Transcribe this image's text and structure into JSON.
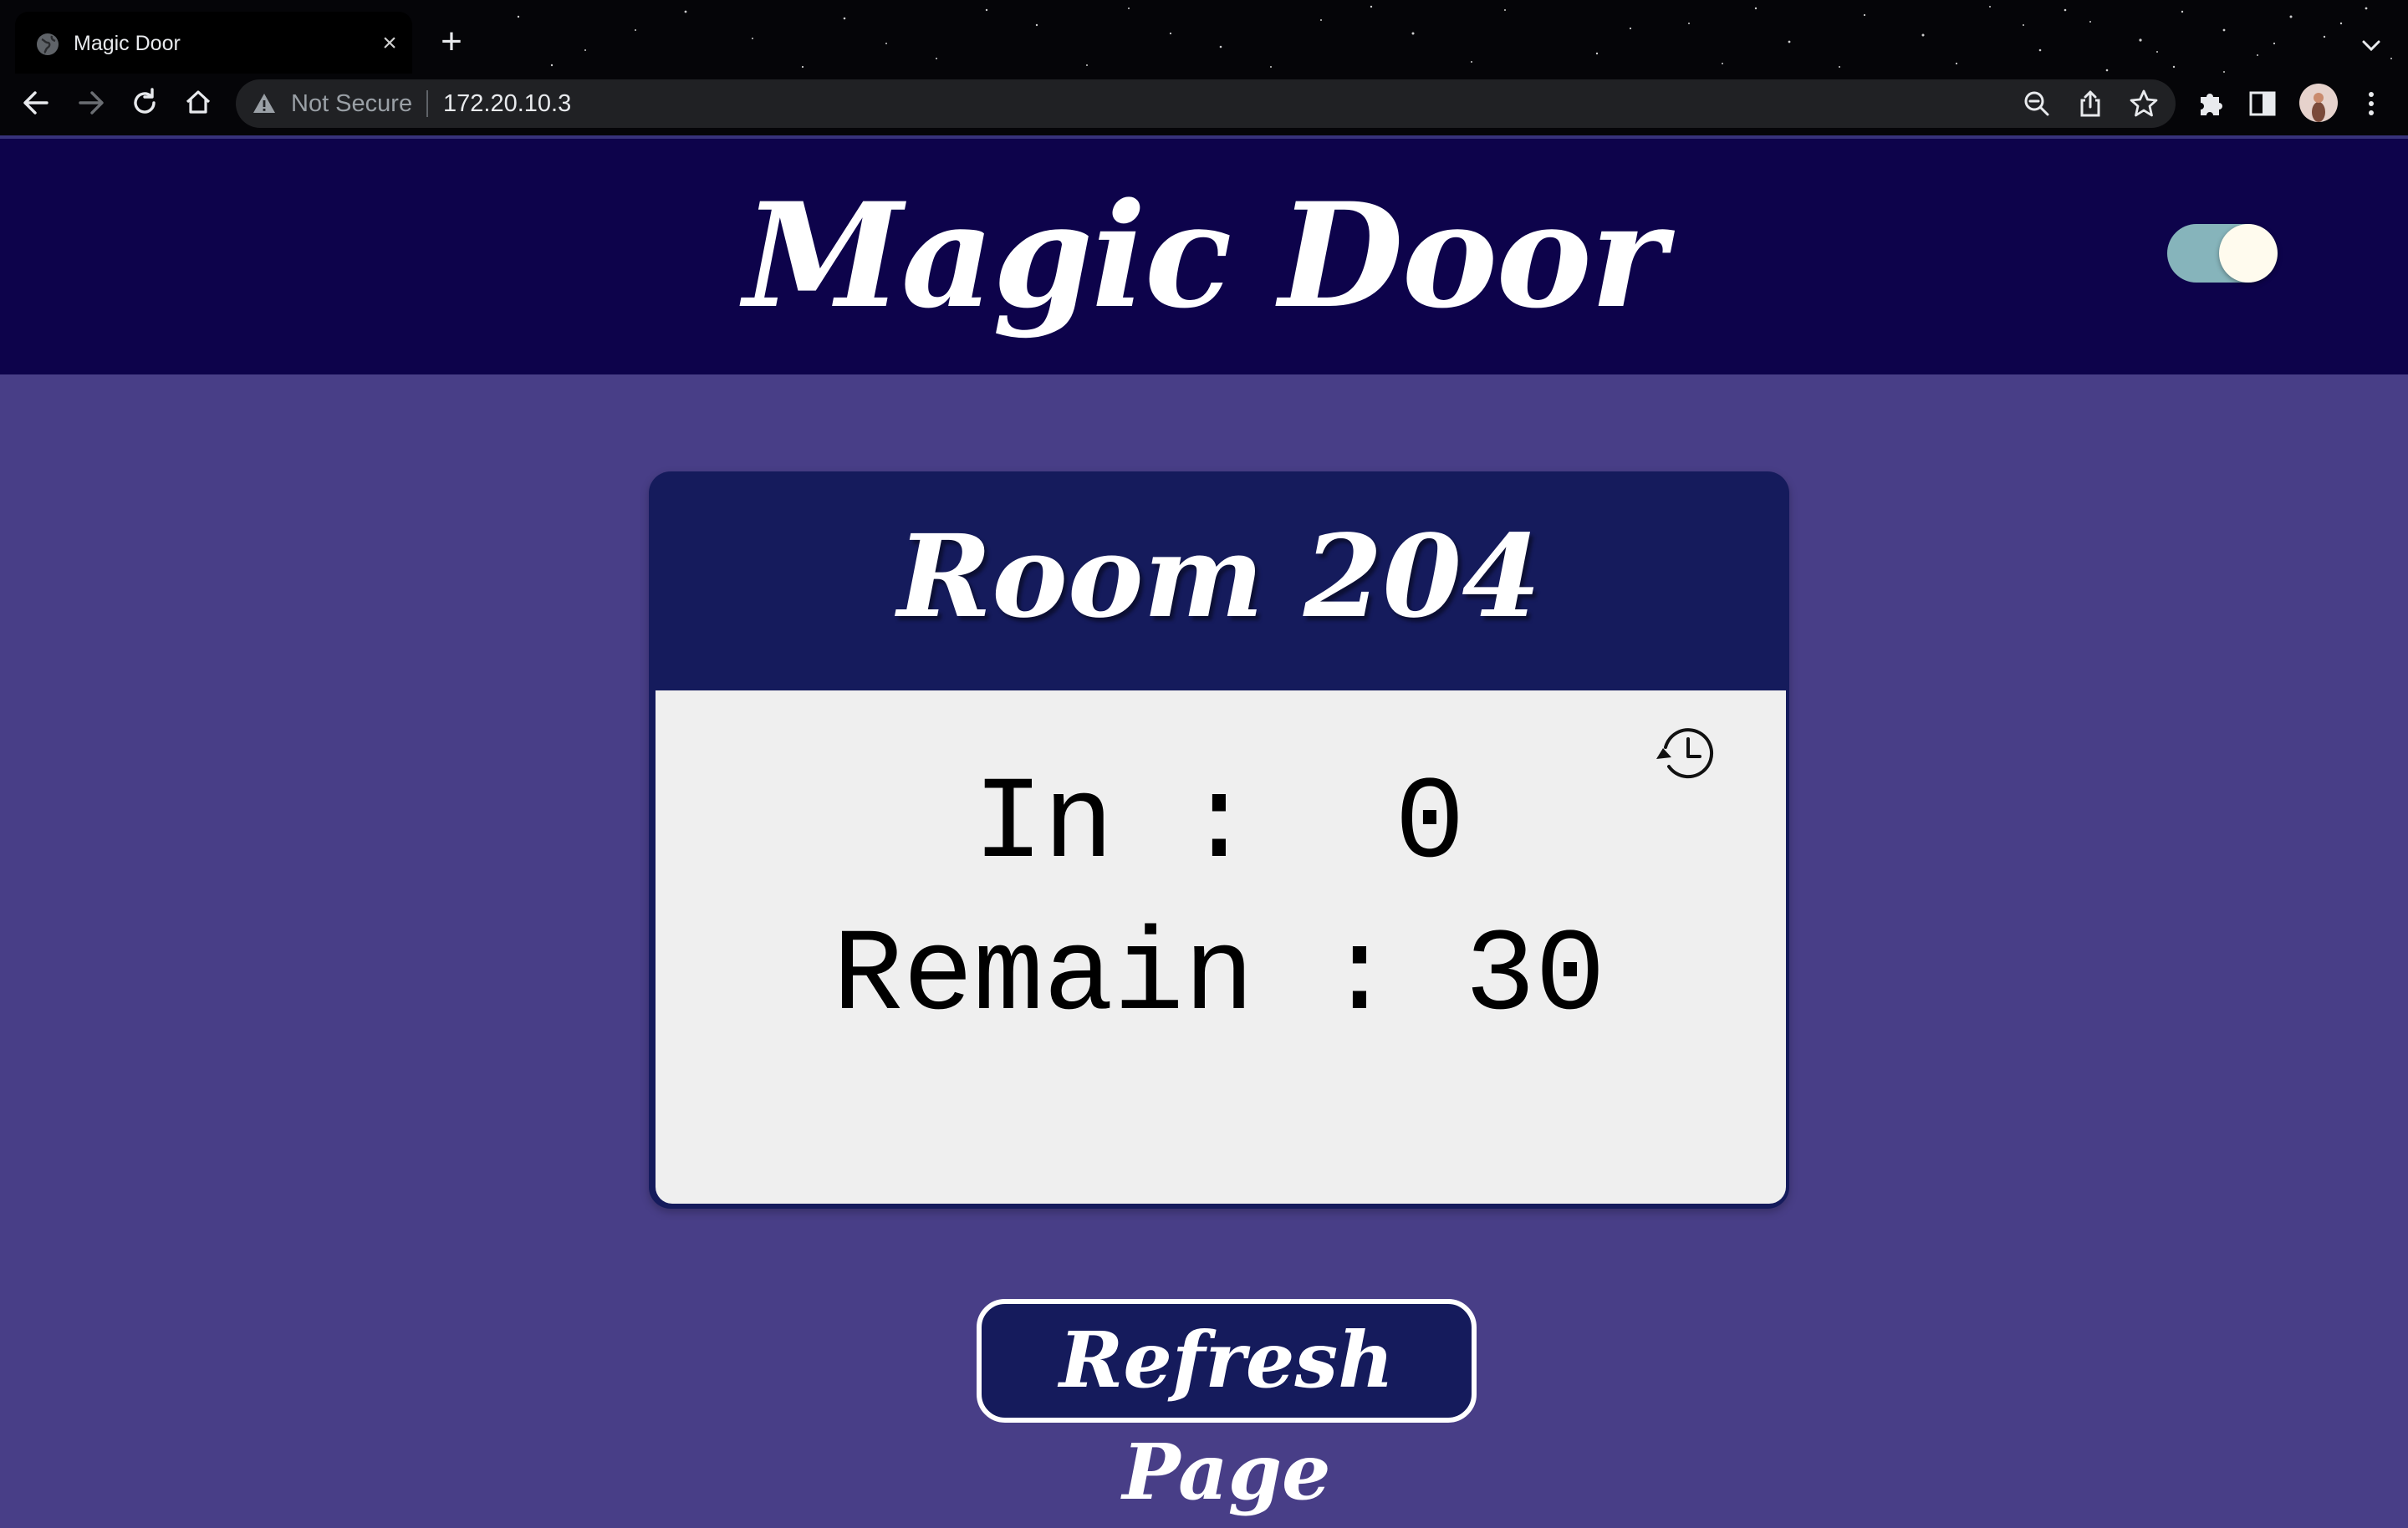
{
  "browser": {
    "tab_title": "Magic Door",
    "tab_close": "×",
    "new_tab": "+",
    "security_label": "Not Secure",
    "url": "172.20.10.3"
  },
  "header": {
    "title": "Magic Door",
    "toggle_on": true
  },
  "room": {
    "title": "Room 204",
    "in_line": "In :  0",
    "remain_line": "Remain : 30"
  },
  "actions": {
    "refresh_label": "Refresh Page"
  },
  "colors": {
    "header_bg": "#0d034b",
    "page_bg": "#483e87",
    "card_header": "#151b5c",
    "card_body": "#efefef",
    "toggle_track": "#86b4bb"
  },
  "icons": {
    "tab": "globe-icon",
    "history": "history-icon",
    "security": "warning-icon"
  }
}
